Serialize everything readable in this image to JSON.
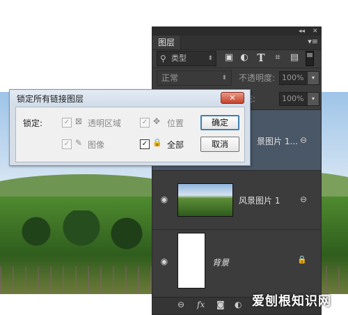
{
  "panel": {
    "tab_label": "图层",
    "collapse_glyph": "◂◂",
    "close_glyph": "✕",
    "menu_glyph": "▾≡",
    "filter": {
      "search_glyph": "⚲",
      "label": "类型",
      "arrow": "⬍"
    },
    "filter_icons": [
      "image-icon",
      "adjustment-icon",
      "type-icon",
      "shape-icon",
      "smart-object-icon"
    ],
    "filter_icon_glyphs": [
      "▣",
      "◐",
      "T",
      "⌗",
      "▤"
    ],
    "blend_mode": "正常",
    "opacity_label": "不透明度:",
    "opacity_value": "100%",
    "fill_label": "填充:",
    "fill_value": "100%",
    "dropdown_glyph": "▾",
    "layers": [
      {
        "name": "景图片 1...",
        "visible": false,
        "selected": true,
        "link_glyph": "⊖"
      },
      {
        "name": "风景图片 1",
        "visible": true,
        "selected": false,
        "link_glyph": "⊖",
        "eye_glyph": "👁"
      },
      {
        "name": "背景",
        "visible": true,
        "selected": false,
        "lock_glyph": "🔒",
        "eye_glyph": "👁"
      }
    ],
    "bottom_icons": {
      "link": "⊖",
      "fx": "fx",
      "mask": "◙",
      "adjust": "◐"
    }
  },
  "dialog": {
    "title": "锁定所有链接图层",
    "close_glyph": "✕",
    "lock_label": "锁定:",
    "options": {
      "transparency": {
        "label": "透明区域",
        "checked": true,
        "enabled": false,
        "glyph": "⊠"
      },
      "position": {
        "label": "位置",
        "checked": true,
        "enabled": false,
        "glyph": "✥"
      },
      "image": {
        "label": "图像",
        "checked": true,
        "enabled": false,
        "glyph": "✎"
      },
      "all": {
        "label": "全部",
        "checked": true,
        "enabled": true,
        "glyph": "🔒"
      }
    },
    "check_glyph": "✓",
    "ok_label": "确定",
    "cancel_label": "取消"
  },
  "watermark": "爱刨根知识网"
}
